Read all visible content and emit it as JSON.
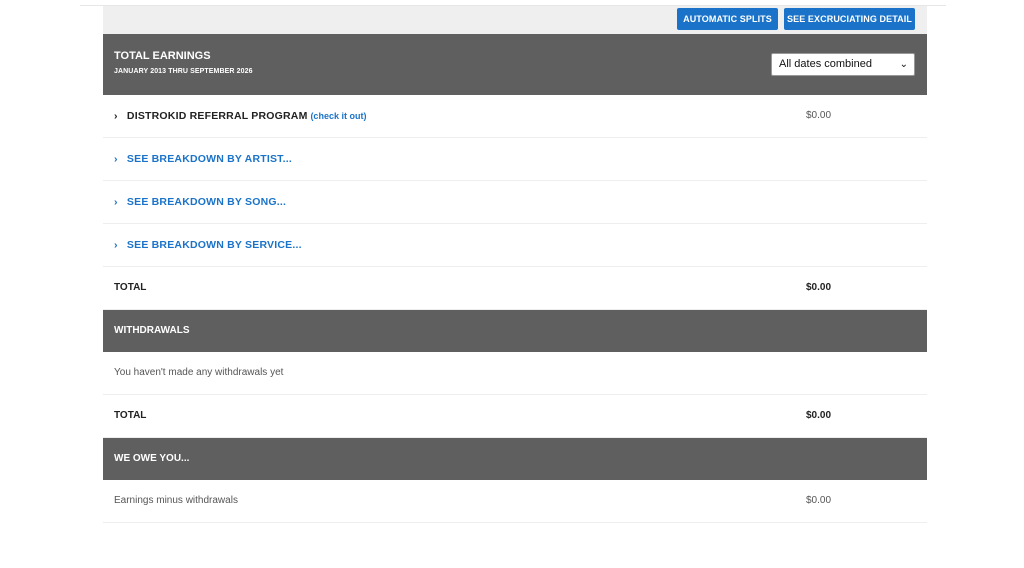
{
  "toolbar": {
    "automatic_splits_label": "AUTOMATIC SPLITS",
    "see_detail_label": "SEE EXCRUCIATING DETAIL"
  },
  "total_earnings": {
    "title": "TOTAL EARNINGS",
    "date_range": "JANUARY 2013 THRU SEPTEMBER 2026",
    "date_select": {
      "selected": "All dates combined"
    },
    "rows": [
      {
        "label": "DISTROKID REFERRAL PROGRAM",
        "link": "(check it out)",
        "amount": "$0.00"
      },
      {
        "label": "SEE BREAKDOWN BY ARTIST..."
      },
      {
        "label": "SEE BREAKDOWN BY SONG..."
      },
      {
        "label": "SEE BREAKDOWN BY SERVICE..."
      }
    ],
    "total_label": "TOTAL",
    "total_amount": "$0.00"
  },
  "withdrawals": {
    "title": "WITHDRAWALS",
    "empty_text": "You haven't made any withdrawals yet",
    "total_label": "TOTAL",
    "total_amount": "$0.00"
  },
  "we_owe_you": {
    "title": "WE OWE YOU...",
    "label": "Earnings minus withdrawals",
    "amount": "$0.00"
  },
  "colors": {
    "accent": "#1a73c9",
    "header_bar": "#5f5f5f"
  },
  "icons": {
    "row_chevron": "chevron-right-icon",
    "select_chevron": "chevron-down-icon"
  }
}
